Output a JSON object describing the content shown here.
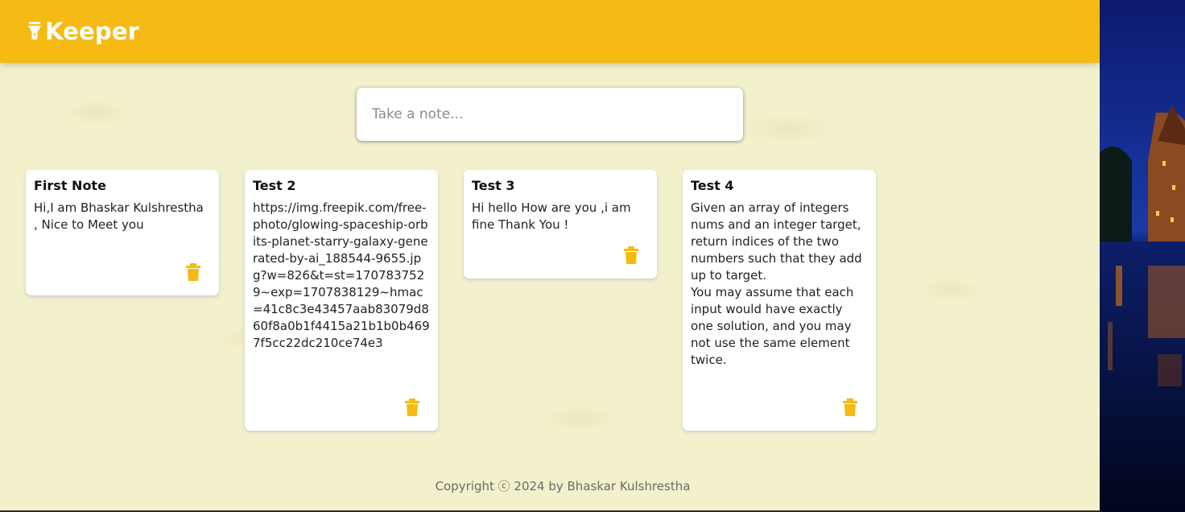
{
  "header": {
    "brand_name": "Keeper",
    "brand_icon": "flashlight-icon"
  },
  "create_note": {
    "placeholder": "Take a note..."
  },
  "notes": [
    {
      "title": "First Note",
      "content": "Hi,I am Bhaskar Kulshrestha , Nice to Meet you"
    },
    {
      "title": "Test 2",
      "content": "https://img.freepik.com/free-photo/glowing-spaceship-orbits-planet-starry-galaxy-generated-by-ai_188544-9655.jpg?w=826&t=st=1707837529~exp=1707838129~hmac=41c8c3e43457aab83079d860f8a0b1f4415a21b1b0b4697f5cc22dc210ce74e3"
    },
    {
      "title": "Test 3",
      "content": "Hi hello How are you ,i am fine Thank You !"
    },
    {
      "title": "Test 4",
      "content": "Given an array of integers nums and an integer target, return indices of the two numbers such that they add up to target.\nYou may assume that each input would have exactly one solution, and you may not use the same element twice."
    }
  ],
  "footer": {
    "text": "Copyright ⓒ 2024 by Bhaskar Kulshrestha"
  },
  "colors": {
    "accent": "#f5ba13",
    "background": "#f2f1cc"
  },
  "icons": {
    "delete": "trash-icon"
  }
}
